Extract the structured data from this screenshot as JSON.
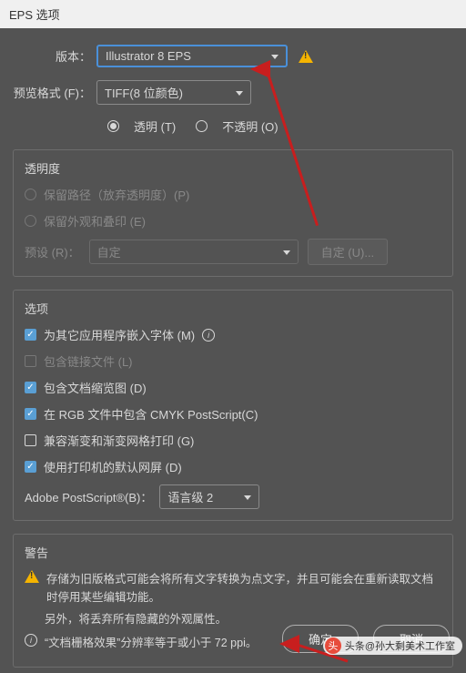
{
  "title": "EPS 选项",
  "version": {
    "label": "版本：",
    "value": "Illustrator 8 EPS"
  },
  "preview": {
    "label": "预览格式 (F)：",
    "value": "TIFF(8 位颜色)",
    "transparent": "透明 (T)",
    "opaque": "不透明 (O)"
  },
  "transparency": {
    "title": "透明度",
    "preserve_paths": "保留路径（放弃透明度）(P)",
    "preserve_appearance": "保留外观和叠印 (E)",
    "preset_label": "预设 (R)：",
    "preset_value": "自定",
    "custom_btn": "自定 (U)..."
  },
  "options": {
    "title": "选项",
    "embed_fonts": "为其它应用程序嵌入字体 (M)",
    "include_linked": "包含链接文件 (L)",
    "include_thumbnail": "包含文档缩览图 (D)",
    "include_cmyk": "在 RGB 文件中包含 CMYK PostScript(C)",
    "compat_gradient": "兼容渐变和渐变网格打印 (G)",
    "use_printer_default": "使用打印机的默认网屏 (D)",
    "ps_label": "Adobe PostScript®(B)：",
    "ps_value": "语言级 2"
  },
  "warnings": {
    "title": "警告",
    "line1": "存储为旧版格式可能会将所有文字转换为点文字，并且可能会在重新读取文档时停用某些编辑功能。",
    "line2": "另外，将丢弃所有隐藏的外观属性。",
    "line3": "“文档栅格效果”分辨率等于或小于 72 ppi。"
  },
  "buttons": {
    "ok": "确定",
    "cancel": "取消"
  },
  "watermark": "头条@孙大剩美术工作室"
}
